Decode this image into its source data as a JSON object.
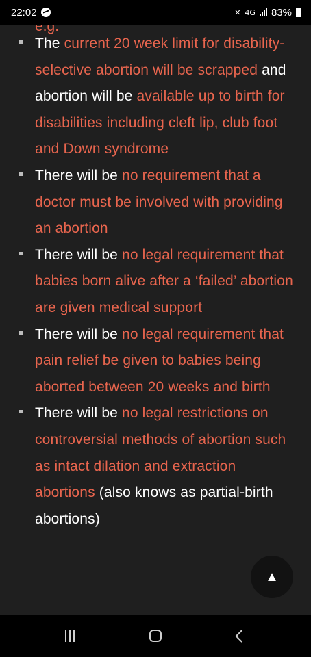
{
  "status_bar": {
    "time": "22:02",
    "network": "4G",
    "battery": "83%"
  },
  "article": {
    "cut_off_text": "e.g.",
    "bullets": [
      {
        "segments": [
          {
            "text": "The ",
            "highlight": false
          },
          {
            "text": "current 20 week limit for disability-selective abortion will be scrapped",
            "highlight": true
          },
          {
            "text": " and abortion will be ",
            "highlight": false
          },
          {
            "text": "available up to birth for disabilities including cleft lip, club foot and Down syndrome",
            "highlight": true
          }
        ]
      },
      {
        "segments": [
          {
            "text": "There will be ",
            "highlight": false
          },
          {
            "text": "no requirement that a doctor must be involved with providing an abortion",
            "highlight": true
          }
        ]
      },
      {
        "segments": [
          {
            "text": "There will be ",
            "highlight": false
          },
          {
            "text": "no legal requirement that babies born alive after a ‘failed’ abortion are given medical support",
            "highlight": true
          }
        ]
      },
      {
        "segments": [
          {
            "text": "There will be ",
            "highlight": false
          },
          {
            "text": "no legal requirement that pain relief be given to babies being aborted between 20 weeks and birth",
            "highlight": true
          }
        ]
      },
      {
        "segments": [
          {
            "text": "There will be ",
            "highlight": false
          },
          {
            "text": "no legal restrictions on controversial methods of abortion such as intact dilation and extraction abortions",
            "highlight": true
          },
          {
            "text": " (also knows as partial-birth abortions)",
            "highlight": false
          }
        ]
      }
    ]
  },
  "scroll_top_button": {
    "icon": "▲"
  },
  "colors": {
    "background": "#1f1f1f",
    "highlight": "#e8654e",
    "text": "#ffffff"
  }
}
